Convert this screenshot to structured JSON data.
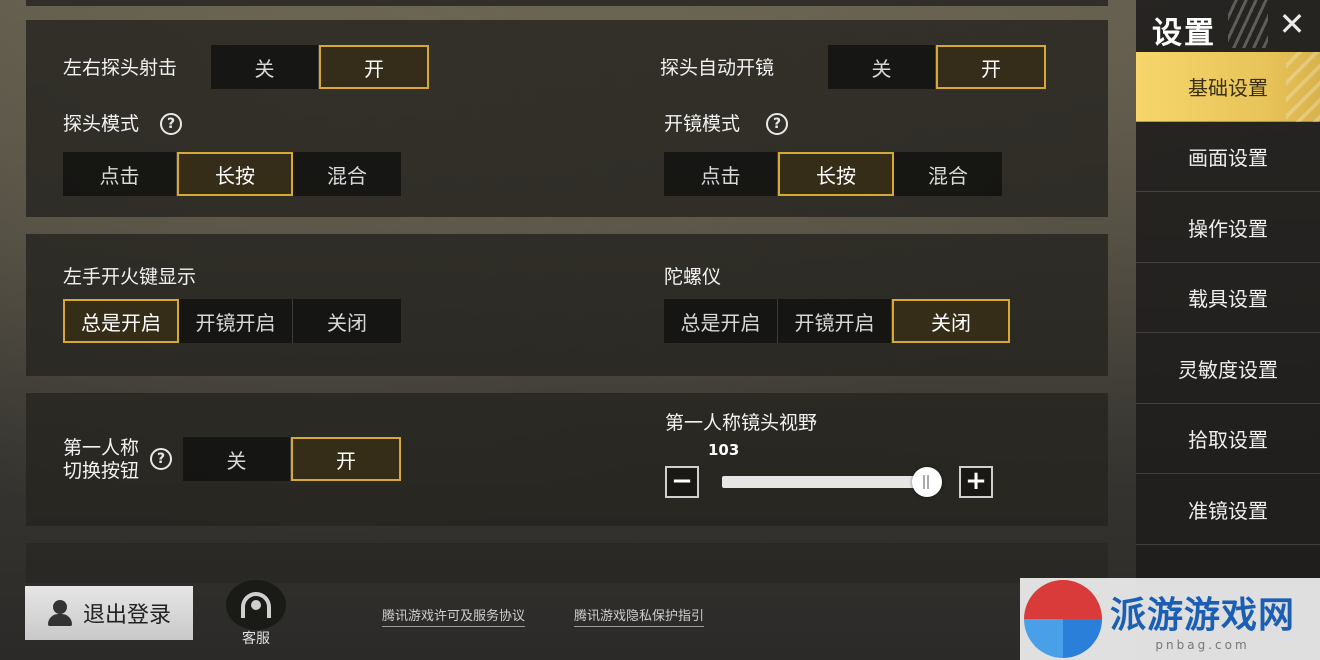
{
  "peek_fire": {
    "label": "左右探头射击",
    "options": [
      "关",
      "开"
    ],
    "selected": "开"
  },
  "peek_auto_scope": {
    "label": "探头自动开镜",
    "options": [
      "关",
      "开"
    ],
    "selected": "开"
  },
  "peek_mode": {
    "label": "探头模式",
    "options": [
      "点击",
      "长按",
      "混合"
    ],
    "selected": "长按"
  },
  "scope_mode": {
    "label": "开镜模式",
    "options": [
      "点击",
      "长按",
      "混合"
    ],
    "selected": "长按"
  },
  "left_fire": {
    "label": "左手开火键显示",
    "options": [
      "总是开启",
      "开镜开启",
      "关闭"
    ],
    "selected": "总是开启"
  },
  "gyroscope": {
    "label": "陀螺仪",
    "options": [
      "总是开启",
      "开镜开启",
      "关闭"
    ],
    "selected": "关闭"
  },
  "fpp_toggle": {
    "label_line1": "第一人称",
    "label_line2": "切换按钮",
    "options": [
      "关",
      "开"
    ],
    "selected": "开"
  },
  "fpp_fov": {
    "label": "第一人称镜头视野",
    "value": "103",
    "fraction": 0.95,
    "minus": "−",
    "plus": "+"
  },
  "help_glyph": "?",
  "sidebar": {
    "title": "设置",
    "close": "✕",
    "items": [
      "基础设置",
      "画面设置",
      "操作设置",
      "载具设置",
      "灵敏度设置",
      "拾取设置",
      "准镜设置"
    ],
    "active": 0
  },
  "bottom": {
    "logout": "退出登录",
    "customer_service": "客服",
    "link_license": "腾讯游戏许可及服务协议",
    "link_privacy": "腾讯游戏隐私保护指引"
  },
  "watermark": {
    "main": "派游游戏网",
    "sub": "pnbag.com"
  },
  "colors": {
    "accent": "#d5a934",
    "active_tab": "#f6d66b"
  }
}
